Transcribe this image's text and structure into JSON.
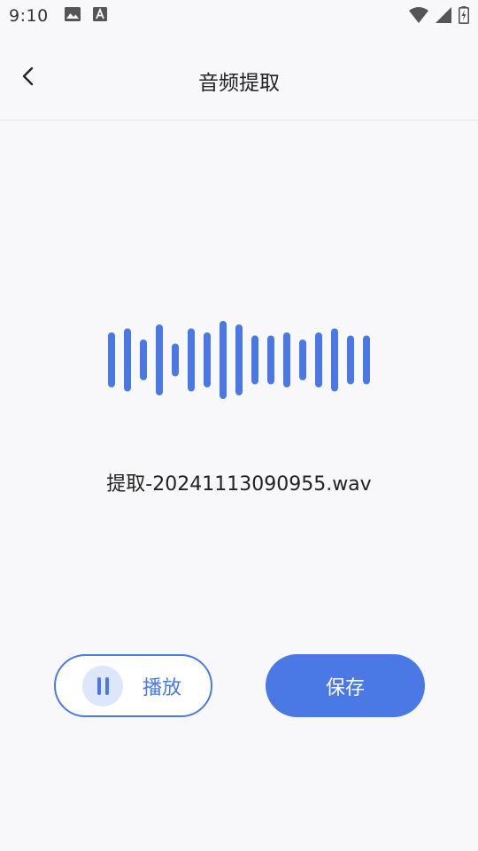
{
  "status_bar": {
    "time": "9:10",
    "left_icons": [
      "image-icon",
      "text-a-icon"
    ],
    "right_icons": [
      "wifi-icon",
      "signal-icon",
      "battery-charging-icon"
    ]
  },
  "header": {
    "title": "音频提取",
    "back_icon": "chevron-left-icon"
  },
  "waveform": {
    "color": "#4a79e6",
    "bar_levels": [
      0.62,
      0.71,
      0.46,
      0.8,
      0.37,
      0.71,
      0.62,
      0.88,
      0.8,
      0.55,
      0.55,
      0.62,
      0.46,
      0.62,
      0.71,
      0.55,
      0.55
    ]
  },
  "file": {
    "name": "提取-20241113090955.wav"
  },
  "actions": {
    "play_label": "播放",
    "play_icon": "pause-icon",
    "save_label": "保存"
  },
  "colors": {
    "accent": "#4a79e6",
    "accent_light": "#dde6fb",
    "background": "#f8f8fa"
  }
}
